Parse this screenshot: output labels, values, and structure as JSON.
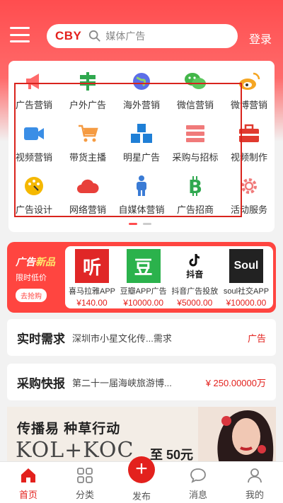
{
  "header": {
    "logo": "CBY",
    "search_placeholder": "媒体广告",
    "login": "登录"
  },
  "categories": [
    {
      "label": "广告营销",
      "icon": "megaphone-icon"
    },
    {
      "label": "户外广告",
      "icon": "signpost-icon"
    },
    {
      "label": "海外营销",
      "icon": "globe-icon"
    },
    {
      "label": "微信营销",
      "icon": "wechat-icon"
    },
    {
      "label": "微博营销",
      "icon": "weibo-icon"
    },
    {
      "label": "视频营销",
      "icon": "video-camera-icon"
    },
    {
      "label": "带货主播",
      "icon": "shopping-cart-icon"
    },
    {
      "label": "明星广告",
      "icon": "cubes-icon"
    },
    {
      "label": "采购与招标",
      "icon": "server-list-icon"
    },
    {
      "label": "视频制作",
      "icon": "toolbox-icon"
    },
    {
      "label": "广告设计",
      "icon": "palette-icon"
    },
    {
      "label": "网络营销",
      "icon": "cloud-icon"
    },
    {
      "label": "自媒体营销",
      "icon": "person-icon"
    },
    {
      "label": "广告招商",
      "icon": "bitcoin-icon"
    },
    {
      "label": "活动服务",
      "icon": "gear-icon"
    }
  ],
  "promo": {
    "title_a": "广告",
    "title_b": "新品",
    "subtitle": "限时低价",
    "button": "去抢购",
    "products": [
      {
        "name": "喜马拉雅APP",
        "price": "¥140.00",
        "logo_text": "听",
        "color": "#e02727"
      },
      {
        "name": "豆瓣APP广告",
        "price": "¥10000.00",
        "logo_text": "豆",
        "color": "#2bb24c"
      },
      {
        "name": "抖音广告投放",
        "price": "¥5000.00",
        "logo_text": "抖音",
        "color": "#ffffff"
      },
      {
        "name": "soul社交APP",
        "price": "¥10000.00",
        "logo_text": "Soul",
        "color": "#222222"
      }
    ]
  },
  "demand": {
    "title": "实时需求",
    "text": "深圳市小星文化传...需求",
    "tag": "广告"
  },
  "purchase": {
    "title": "采购快报",
    "text": "第二十一届海峡旅游博...",
    "amount": "¥ 250.00000万"
  },
  "banner": {
    "headline": "传播易 种草行动",
    "kol": "KOL+KOC",
    "sub": "至 50元"
  },
  "tabs": [
    {
      "label": "首页",
      "icon": "home-icon"
    },
    {
      "label": "分类",
      "icon": "grid-icon"
    },
    {
      "label": "发布",
      "icon": "plus-icon"
    },
    {
      "label": "消息",
      "icon": "chat-bubble-icon"
    },
    {
      "label": "我的",
      "icon": "user-icon"
    }
  ],
  "colors": {
    "brand": "#e3211d",
    "header": "#ff4d4f"
  }
}
